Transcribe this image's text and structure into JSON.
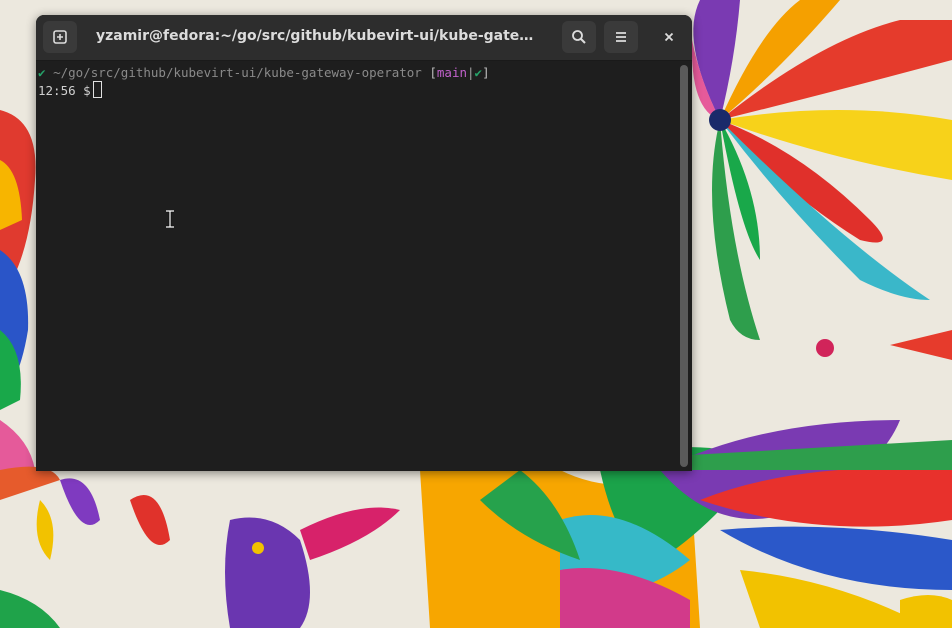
{
  "window": {
    "title": "yzamir@fedora:~/go/src/github/kubevirt-ui/kube-gateway-ope…",
    "new_tab_icon": "new-tab-icon",
    "search_icon": "search-icon",
    "menu_icon": "hamburger-menu-icon",
    "close_icon": "close-icon"
  },
  "terminal": {
    "prompt_line": {
      "status_mark": "✔",
      "path": "~/go/src/github/kubevirt-ui/kube-gateway-operator",
      "bracket_open": "[",
      "branch": "main",
      "separator": "|",
      "git_status": "✔",
      "bracket_close": "]"
    },
    "input_line": {
      "time": "12:56",
      "prompt": "$"
    }
  },
  "colors": {
    "terminal_bg": "#1e1e1e",
    "headerbar_bg": "#2d2d2d",
    "ok_green": "#26a269",
    "branch_purple": "#c061cb"
  }
}
